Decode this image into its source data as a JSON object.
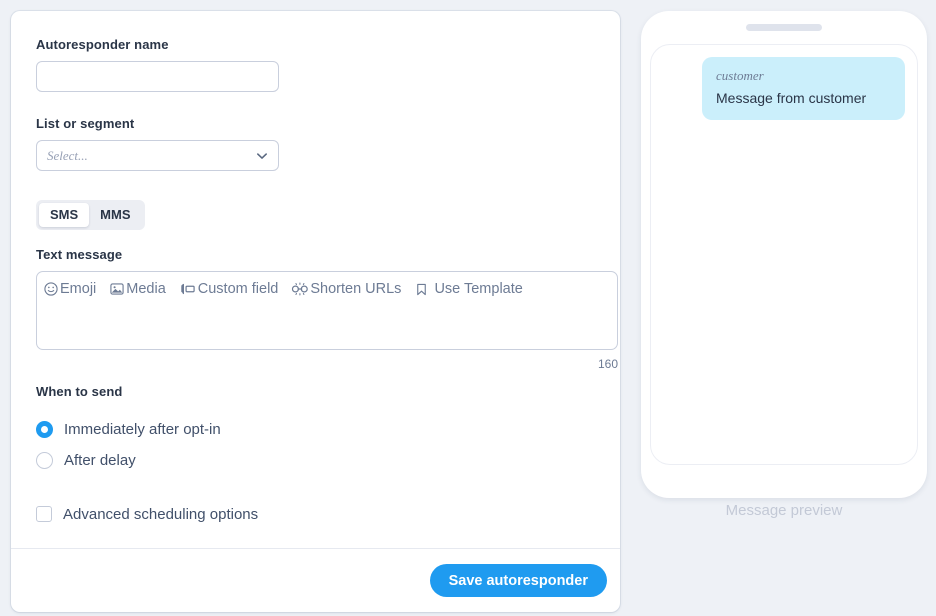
{
  "form": {
    "autoresponder_name": {
      "label": "Autoresponder name",
      "value": "",
      "placeholder": ""
    },
    "list_or_segment": {
      "label": "List or segment",
      "selected": "Select...",
      "options": [
        "Select..."
      ]
    },
    "message_type": {
      "options": [
        {
          "label": "SMS",
          "active": true
        },
        {
          "label": "MMS",
          "active": false
        }
      ]
    },
    "text_message": {
      "label": "Text message",
      "value": "",
      "char_count": "160",
      "toolbar": [
        {
          "label": "Emoji",
          "icon": "smiley-icon"
        },
        {
          "label": "Media",
          "icon": "image-icon"
        },
        {
          "label": "Custom field",
          "icon": "custom-field-icon"
        },
        {
          "label": "Shorten URLs",
          "icon": "link-icon"
        },
        {
          "label": "Use Template",
          "icon": "bookmark-icon"
        }
      ]
    },
    "when_to_send": {
      "label": "When to send",
      "options": [
        {
          "label": "Immediately after opt-in",
          "selected": true
        },
        {
          "label": "After delay",
          "selected": false
        }
      ]
    },
    "advanced_scheduling": {
      "label": "Advanced scheduling options",
      "checked": false
    },
    "footer": {
      "save_label": "Save autoresponder"
    }
  },
  "preview": {
    "caption": "Message preview",
    "message": {
      "sender": "customer",
      "body": "Message from customer"
    }
  },
  "colors": {
    "accent": "#1f9bf0",
    "page_background": "#eef1f6",
    "bubble": "#cbeffb",
    "label_text": "#2a3547",
    "muted_text": "#6d7b94"
  }
}
